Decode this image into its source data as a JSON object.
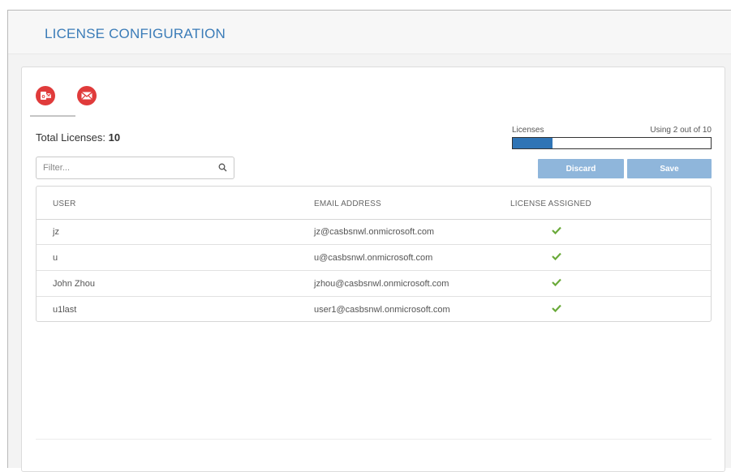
{
  "page": {
    "title": "LICENSE CONFIGURATION"
  },
  "tabs": [
    {
      "name": "outlook-icon",
      "color": "#e03b3b",
      "active": true
    },
    {
      "name": "mail-icon",
      "color": "#e03b3b",
      "active": false
    }
  ],
  "summary": {
    "total_label": "Total Licenses:",
    "total_value": "10"
  },
  "licenses": {
    "label": "Licenses",
    "usage_text": "Using 2 out of 10",
    "used": 2,
    "total": 10,
    "bar_color": "#2f74b5"
  },
  "filter": {
    "placeholder": "Filter...",
    "value": ""
  },
  "actions": {
    "discard_label": "Discard",
    "save_label": "Save",
    "button_color": "#8fb6db"
  },
  "table": {
    "columns": [
      "USER",
      "EMAIL ADDRESS",
      "LICENSE ASSIGNED"
    ],
    "rows": [
      {
        "user": "jz",
        "email": "jz@casbsnwl.onmicrosoft.com",
        "assigned": true
      },
      {
        "user": "u",
        "email": "u@casbsnwl.onmicrosoft.com",
        "assigned": true
      },
      {
        "user": "John Zhou",
        "email": "jzhou@casbsnwl.onmicrosoft.com",
        "assigned": true
      },
      {
        "user": "u1last",
        "email": "user1@casbsnwl.onmicrosoft.com",
        "assigned": true
      }
    ],
    "check_color": "#6aaa3a"
  }
}
